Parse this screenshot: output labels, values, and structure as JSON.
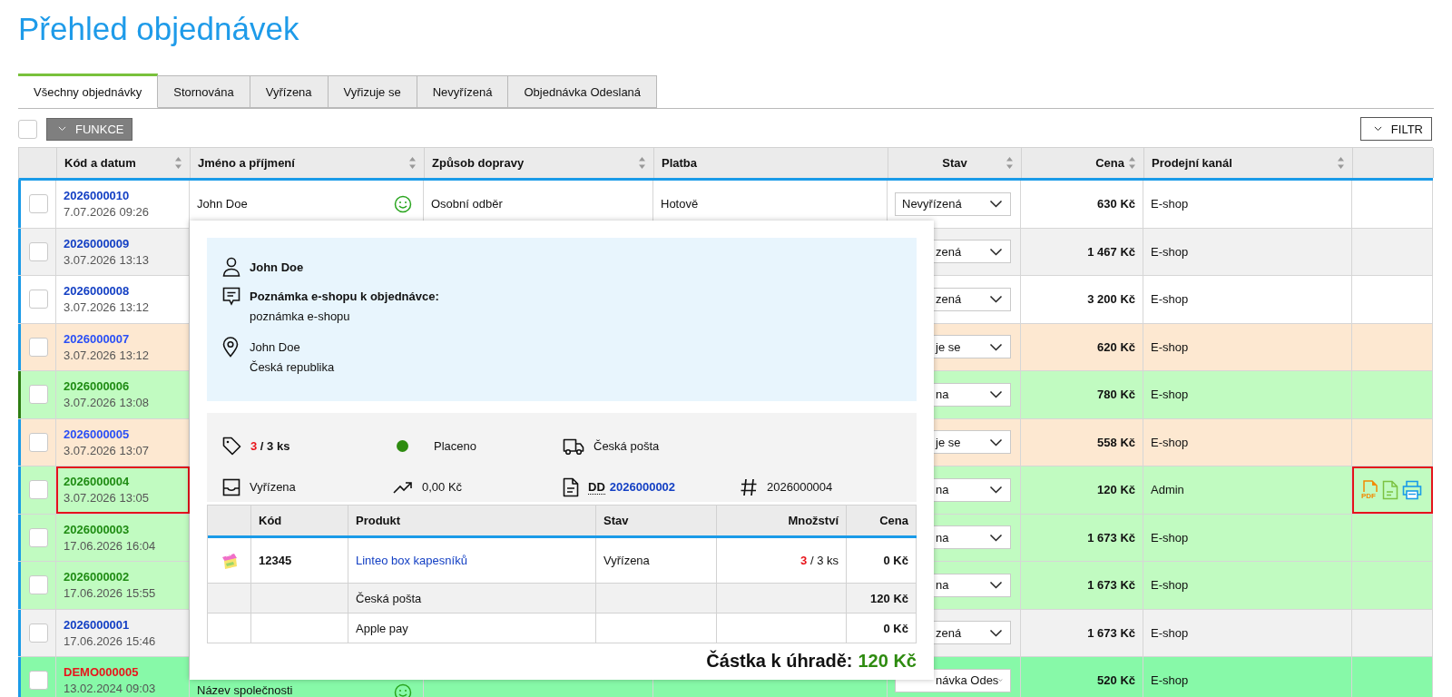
{
  "title": "Přehled objednávek",
  "tabs": [
    {
      "label": "Všechny objednávky",
      "selected": true
    },
    {
      "label": "Stornována",
      "selected": false
    },
    {
      "label": "Vyřízena",
      "selected": false
    },
    {
      "label": "Vyřizuje se",
      "selected": false
    },
    {
      "label": "Nevyřízená",
      "selected": false
    },
    {
      "label": "Objednávka Odeslaná",
      "selected": false
    }
  ],
  "toolbar": {
    "select_all_checked": false,
    "functions_button": "FUNKCE",
    "filter_button": "FILTR"
  },
  "table": {
    "columns": [
      {
        "label": "Kód a datum",
        "sortable": true
      },
      {
        "label": "Jméno a příjmení",
        "sortable": true
      },
      {
        "label": "Způsob dopravy",
        "sortable": true
      },
      {
        "label": "Platba",
        "sortable": false
      },
      {
        "label": "Stav",
        "sortable": true
      },
      {
        "label": "Cena",
        "sortable": true
      },
      {
        "label": "Prodejní kanál",
        "sortable": true
      }
    ],
    "rows": [
      {
        "code": "2026000010",
        "date": "7.07.2026 09:26",
        "name": "John Doe",
        "satisfied": true,
        "shipping": "Osobní odběr",
        "payment": "Hotově",
        "status": "Nevyřízená",
        "price": "630 Kč",
        "channel": "E-shop",
        "color": "#ffffff",
        "kind": "new",
        "completed": false,
        "checked": false,
        "highlighted": false
      },
      {
        "code": "2026000009",
        "date": "3.07.2026 13:13",
        "status": "zená",
        "price": "1 467 Kč",
        "channel": "E-shop",
        "color": "#f1f1f1",
        "kind": "new",
        "completed": false,
        "checked": false,
        "highlighted": false
      },
      {
        "code": "2026000008",
        "date": "3.07.2026 13:12",
        "status": "zená",
        "price": "3 200 Kč",
        "channel": "E-shop",
        "color": "#ffffff",
        "kind": "new",
        "completed": false,
        "checked": false,
        "highlighted": false
      },
      {
        "code": "2026000007",
        "date": "3.07.2026 13:12",
        "status": "je se",
        "price": "620 Kč",
        "channel": "E-shop",
        "color": "#fde8d1",
        "kind": "processing",
        "completed": false,
        "checked": false,
        "highlighted": false
      },
      {
        "code": "2026000006",
        "date": "3.07.2026 13:08",
        "status": "na",
        "price": "780 Kč",
        "channel": "E-shop",
        "color": "#c1fbc1",
        "kind": "done",
        "completed": true,
        "checked": false,
        "highlighted": false
      },
      {
        "code": "2026000005",
        "date": "3.07.2026 13:07",
        "status": "je se",
        "price": "558 Kč",
        "channel": "E-shop",
        "color": "#fde8d1",
        "kind": "processing",
        "completed": false,
        "checked": false,
        "highlighted": false
      },
      {
        "code": "2026000004",
        "date": "3.07.2026 13:05",
        "status": "na",
        "price": "120 Kč",
        "channel": "Admin",
        "color": "#c1fbc1",
        "kind": "done",
        "completed": false,
        "checked": false,
        "highlighted": true,
        "actions": [
          {
            "kind": "pdf",
            "label": "PDF"
          },
          {
            "kind": "document"
          },
          {
            "kind": "print"
          }
        ]
      },
      {
        "code": "2026000003",
        "date": "17.06.2026 16:04",
        "status": "na",
        "price": "1 673 Kč",
        "channel": "E-shop",
        "color": "#c1fbc1",
        "kind": "done",
        "completed": false,
        "checked": false,
        "highlighted": false
      },
      {
        "code": "2026000002",
        "date": "17.06.2026 15:55",
        "status": "na",
        "price": "1 673 Kč",
        "channel": "E-shop",
        "color": "#c1fbc1",
        "kind": "done",
        "completed": false,
        "checked": false,
        "highlighted": false
      },
      {
        "code": "2026000001",
        "date": "17.06.2026 15:46",
        "status": "zená",
        "price": "1 673 Kč",
        "channel": "E-shop",
        "color": "#f1f1f1",
        "kind": "new",
        "completed": false,
        "checked": false,
        "highlighted": false
      },
      {
        "code": "DEMO000005",
        "date": "13.02.2024 09:03",
        "name": "Název společnosti",
        "satisfied": true,
        "status": "návka Odes",
        "price": "520 Kč",
        "channel": "E-shop",
        "color": "#87f9a8",
        "kind": "demo",
        "completed": false,
        "checked": false,
        "highlighted": false
      }
    ]
  },
  "popup": {
    "customer": "John Doe",
    "note_label": "Poznámka e-shopu k objednávce:",
    "note": "poznámka e-shopu",
    "address": [
      "John Doe",
      "Česká republika"
    ],
    "summary": {
      "quantity_done": "3",
      "quantity_total": "/ 3 ks",
      "paid": true,
      "payment_state": "Placeno",
      "carrier": "Česká pošta",
      "status": "Vyřízena",
      "margin": "0,00 Kč",
      "document_prefix": "DD",
      "document_number": "2026000002",
      "order_number": "2026000004"
    },
    "items": {
      "columns": [
        "Kód",
        "Produkt",
        "Stav",
        "Množství",
        "Cena"
      ],
      "rows": [
        {
          "kind": "product",
          "code": "12345",
          "name": "Linteo box kapesníků",
          "status": "Vyřízena",
          "quantity_done": "3",
          "quantity_total": "/ 3 ks",
          "price": "0 Kč"
        },
        {
          "kind": "fee",
          "name": "Česká pošta",
          "price": "120 Kč"
        },
        {
          "kind": "fee",
          "name": "Apple pay",
          "price": "0 Kč"
        }
      ]
    },
    "total_label": "Částka k úhradě:",
    "total": "120 Kč"
  }
}
